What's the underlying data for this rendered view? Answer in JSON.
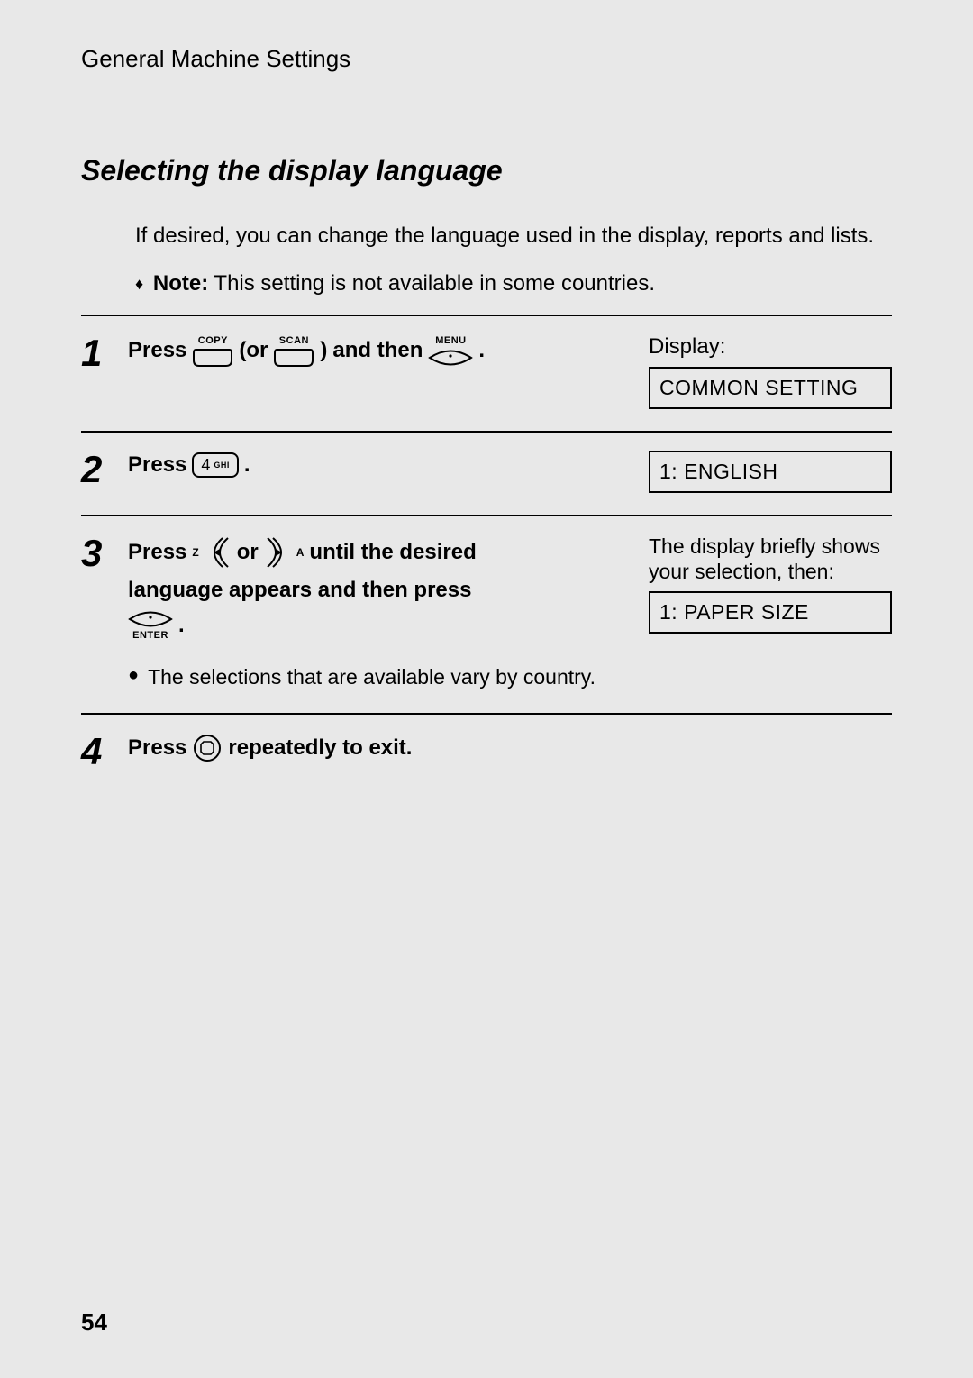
{
  "header": {
    "chapter": "General Machine Settings"
  },
  "section": {
    "title": "Selecting the display language"
  },
  "intro": "If desired, you can change the language used in the display, reports and lists.",
  "note": {
    "prefix": "Note:",
    "text": "This setting is not available in some countries."
  },
  "words": {
    "press": "Press",
    "or_paren_open": "(or",
    "paren_close": ")",
    "and_then": "and then",
    "or": "or",
    "repeatedly_exit": "repeatedly to exit.",
    "period": "."
  },
  "keycaps": {
    "copy": "COPY",
    "scan": "SCAN",
    "menu": "MENU",
    "enter": "ENTER",
    "four": "4",
    "ghi": "GHI",
    "z": "Z",
    "a": "A"
  },
  "steps": {
    "s1": {
      "num": "1",
      "display_label": "Display:",
      "display_value": "COMMON SETTING"
    },
    "s2": {
      "num": "2",
      "display_value": "1: ENGLISH"
    },
    "s3": {
      "num": "3",
      "line1_part1": "until the desired",
      "line2": "language appears and then press",
      "bullet": "The selections that are available vary by country.",
      "display_note": "The display briefly shows your selection, then:",
      "display_value": "1: PAPER SIZE"
    },
    "s4": {
      "num": "4"
    }
  },
  "page_number": "54"
}
